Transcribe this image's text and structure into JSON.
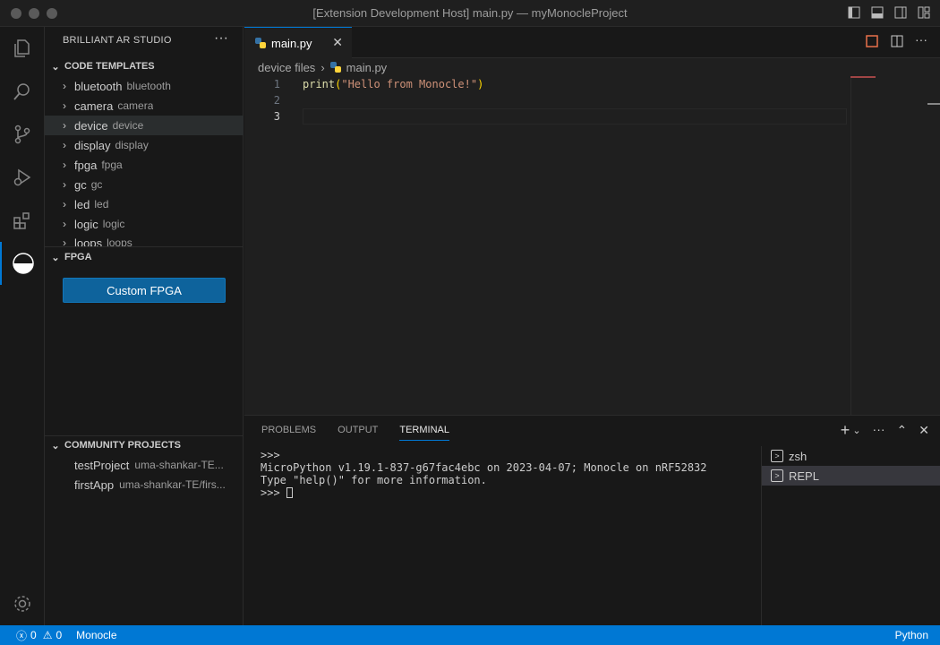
{
  "window": {
    "title": "[Extension Development Host] main.py — myMonocleProject"
  },
  "sidebar": {
    "title": "BRILLIANT AR STUDIO",
    "code_templates": {
      "header": "CODE TEMPLATES",
      "items": [
        {
          "label": "bluetooth",
          "desc": "bluetooth"
        },
        {
          "label": "camera",
          "desc": "camera"
        },
        {
          "label": "device",
          "desc": "device"
        },
        {
          "label": "display",
          "desc": "display"
        },
        {
          "label": "fpga",
          "desc": "fpga"
        },
        {
          "label": "gc",
          "desc": "gc"
        },
        {
          "label": "led",
          "desc": "led"
        },
        {
          "label": "logic",
          "desc": "logic"
        },
        {
          "label": "loops",
          "desc": "loops"
        }
      ]
    },
    "fpga": {
      "header": "FPGA",
      "button": "Custom FPGA"
    },
    "community": {
      "header": "COMMUNITY PROJECTS",
      "items": [
        {
          "label": "testProject",
          "desc": "uma-shankar-TE..."
        },
        {
          "label": "firstApp",
          "desc": "uma-shankar-TE/firs..."
        }
      ]
    }
  },
  "editor": {
    "tab": "main.py",
    "breadcrumb": {
      "folder": "device files",
      "file": "main.py"
    },
    "lines": [
      {
        "num": "1",
        "fn": "print",
        "open": "(",
        "str": "\"Hello from Monocle!\"",
        "close": ")"
      },
      {
        "num": "2"
      },
      {
        "num": "3"
      }
    ]
  },
  "panel": {
    "tabs": [
      "PROBLEMS",
      "OUTPUT",
      "TERMINAL"
    ],
    "terminal": {
      "line1": ">>>",
      "line2": "MicroPython v1.19.1-837-g67fac4ebc on 2023-04-07; Monocle on nRF52832",
      "line3": "Type \"help()\" for more information.",
      "prompt": ">>> "
    },
    "terminals": [
      "zsh",
      "REPL"
    ]
  },
  "status": {
    "errors": "0",
    "warnings": "0",
    "project": "Monocle",
    "language": "Python"
  },
  "colors": {
    "accent": "#0078d4",
    "button": "#0e639c",
    "statusbar": "#0078d4"
  }
}
